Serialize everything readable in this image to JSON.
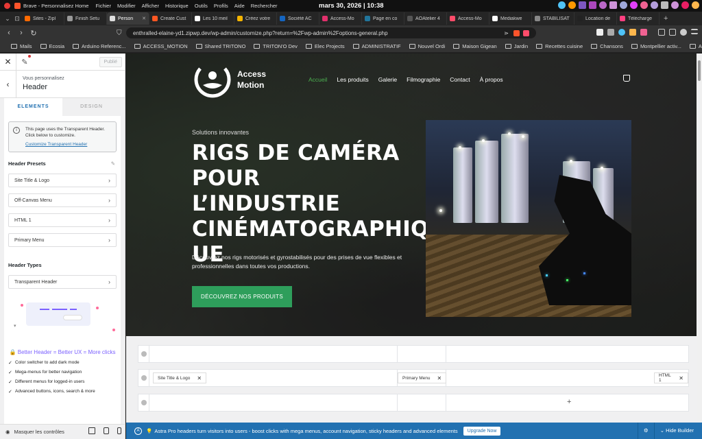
{
  "os": {
    "app_name": "Brave - Personnalisez Home",
    "menus": [
      "Fichier",
      "Modifier",
      "Afficher",
      "Historique",
      "Outils",
      "Profils",
      "Aide",
      "Rechercher"
    ],
    "clock": "mars 30, 2026 | 10:38"
  },
  "browser": {
    "tabs": [
      {
        "label": "Sites - Zipl",
        "color": "#ff6a00"
      },
      {
        "label": "Finish Setu",
        "color": "#999999"
      },
      {
        "label": "Person",
        "color": "#dddddd",
        "active": true
      },
      {
        "label": "Create Cust",
        "color": "#ff5722"
      },
      {
        "label": "Les 10 meil",
        "color": "#ffffff"
      },
      {
        "label": "Créez votre",
        "color": "#f4b400"
      },
      {
        "label": "Société AC",
        "color": "#1565c0"
      },
      {
        "label": "Access-Mo",
        "color": "#e1306c"
      },
      {
        "label": "Page en co",
        "color": "#21759b"
      },
      {
        "label": "AOAtelier 4",
        "color": "#555555"
      },
      {
        "label": "Access-Mo",
        "color": "#ff4c6a"
      },
      {
        "label": "Mediakwe",
        "color": "#ffffff"
      },
      {
        "label": "STABILISAT",
        "color": "#888888"
      },
      {
        "label": "Location de",
        "color": "#222222"
      },
      {
        "label": "Télécharge",
        "color": "#ff4081"
      }
    ],
    "url": "enthralled-elaine-yd1.zipwp.dev/wp-admin/customize.php?return=%2Fwp-admin%2Foptions-general.php",
    "bookmarks": [
      "Mails",
      "Ecosia",
      "Arduino Referenc...",
      "ACCESS_MOTION",
      "Shared TRITONO",
      "TRITON'O Dev",
      "Elec Projects",
      "ADMINISTRATIF",
      "Nouvel Ordi",
      "Maison Gigean",
      "Jardin",
      "Recettes cuisine",
      "Chansons",
      "Montpellier activ...",
      "Assistant Op infos"
    ]
  },
  "customizer": {
    "publish_label": "Publié",
    "crumb_small": "Vous personnalisez",
    "crumb_title": "Header",
    "tab_elements": "ELEMENTS",
    "tab_design": "DESIGN",
    "notice_text": "This page uses the Transparent Header. Click below to customize.",
    "notice_link": "Customize Transparent Header",
    "presets_title": "Header Presets",
    "presets": [
      "Site Title & Logo",
      "Off-Canvas Menu",
      "HTML 1",
      "Primary Menu"
    ],
    "types_title": "Header Types",
    "types": [
      "Transparent Header"
    ],
    "promo_title": "🔒 Better Header = Better UX = More clicks",
    "features": [
      "Color switcher to add dark mode",
      "Mega-menus for better navigation",
      "Different menus for logged-in users",
      "Advanced buttons, icons, search & more"
    ],
    "hide_controls": "Masquer les contrôles"
  },
  "site": {
    "logo_line1": "Access",
    "logo_line2": "Motion",
    "nav": [
      "Accueil",
      "Les produits",
      "Galerie",
      "Filmographie",
      "Contact",
      "À propos"
    ],
    "tagline": "Solutions innovantes",
    "hero_title": "RIGS DE CAMÉRA POUR L’INDUSTRIE CINÉMATOGRAPHIQ UE",
    "hero_desc": "Découvrez nos rigs motorisés et gyrostabilisés pour des prises de vue flexibles et professionnelles dans toutes vos productions.",
    "cta": "DÉCOUVREZ NOS PRODUITS",
    "accent": "#2e9e5b"
  },
  "builder": {
    "chips": [
      "Site Title & Logo",
      "Primary Menu",
      "HTML 1"
    ],
    "plus": "+"
  },
  "astra": {
    "message": "Astra Pro headers turn visitors into users - boost clicks with mega menus, account navigation, sticky headers and advanced elements",
    "upgrade": "Upgrade Now",
    "hide_builder": "Hide Builder",
    "color": "#2271b1"
  }
}
